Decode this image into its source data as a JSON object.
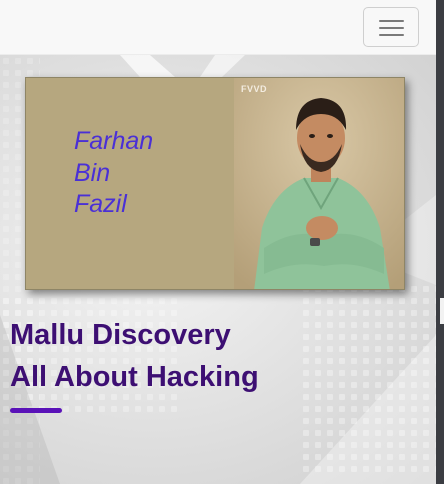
{
  "navbar": {
    "toggler_label": "Toggle navigation"
  },
  "hero": {
    "card": {
      "name_lines": [
        "Farhan",
        "Bin",
        "Fazil"
      ],
      "photo_watermark": "FVVD"
    },
    "headline_lines": [
      "Mallu Discovery",
      "All About Hacking"
    ]
  },
  "colors": {
    "headline": "#3d0f73",
    "name": "#4a30d6",
    "card_background": "#b6a77f",
    "accent_underline": "#5a12b8",
    "shirt": "#8fc39a"
  },
  "icons": {
    "toggler": "hamburger-menu-icon"
  }
}
